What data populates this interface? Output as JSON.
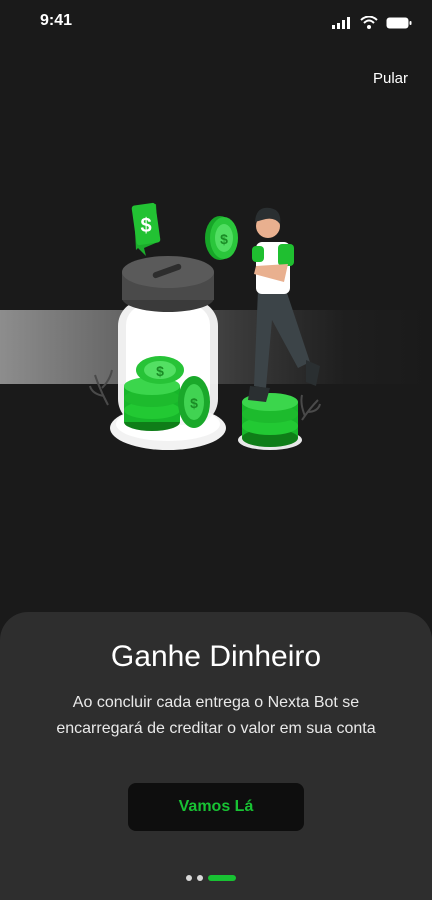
{
  "status_bar": {
    "time": "9:41",
    "icons": [
      "signal-icon",
      "wifi-icon",
      "battery-icon"
    ]
  },
  "header": {
    "skip_label": "Pular"
  },
  "onboarding": {
    "title": "Ganhe Dinheiro",
    "description": "Ao concluir cada entrega o Nexta Bot se encarregará de creditar o valor em sua conta",
    "cta_label": "Vamos Lá",
    "current_page": 3,
    "total_pages": 3
  },
  "colors": {
    "background": "#1a1a1a",
    "sheet": "#2e2e2e",
    "accent": "#18c233"
  }
}
